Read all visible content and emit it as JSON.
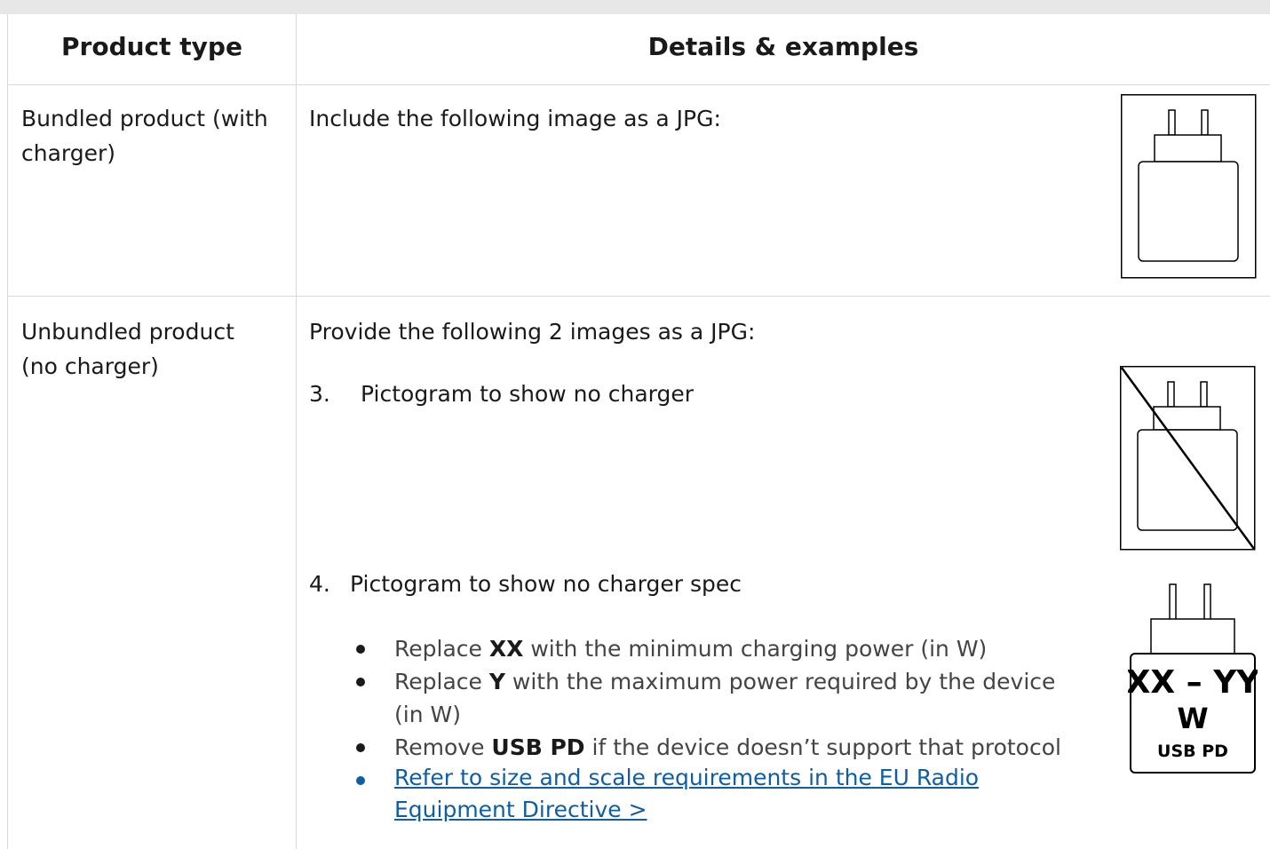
{
  "table": {
    "headers": {
      "product_type": "Product type",
      "details": "Details & examples"
    },
    "row_bundled": {
      "product_line1": "Bundled product (with",
      "product_line2": "charger)",
      "instruction": "Include the following image as a JPG:",
      "image_icon": "charger-icon"
    },
    "row_unbundled": {
      "product_line1": "Unbundled product",
      "product_line2": "(no charger)",
      "instruction": "Provide the following 2 images as a JPG:",
      "item3": {
        "number": "3.",
        "text": "Pictogram to show no charger",
        "image_icon": "no-charger-icon"
      },
      "item4": {
        "number": "4.",
        "text": "Pictogram to show no charger spec",
        "bullets": [
          {
            "pre": "Replace ",
            "bold": "XX",
            "post": " with the minimum charging power (in W)"
          },
          {
            "pre": "Replace ",
            "bold": "Y",
            "post": " with the maximum power required by the device",
            "line2": "(in W)"
          },
          {
            "pre": "Remove ",
            "bold": "USB PD",
            "post": " if the device doesn’t support that protocol"
          }
        ],
        "link_line1": "Refer to size and scale requirements in the EU Radio",
        "link_line2": "Equipment Directive >",
        "badge": {
          "line1": "XX – YY",
          "line2": "W",
          "line3": "USB PD"
        }
      }
    }
  }
}
